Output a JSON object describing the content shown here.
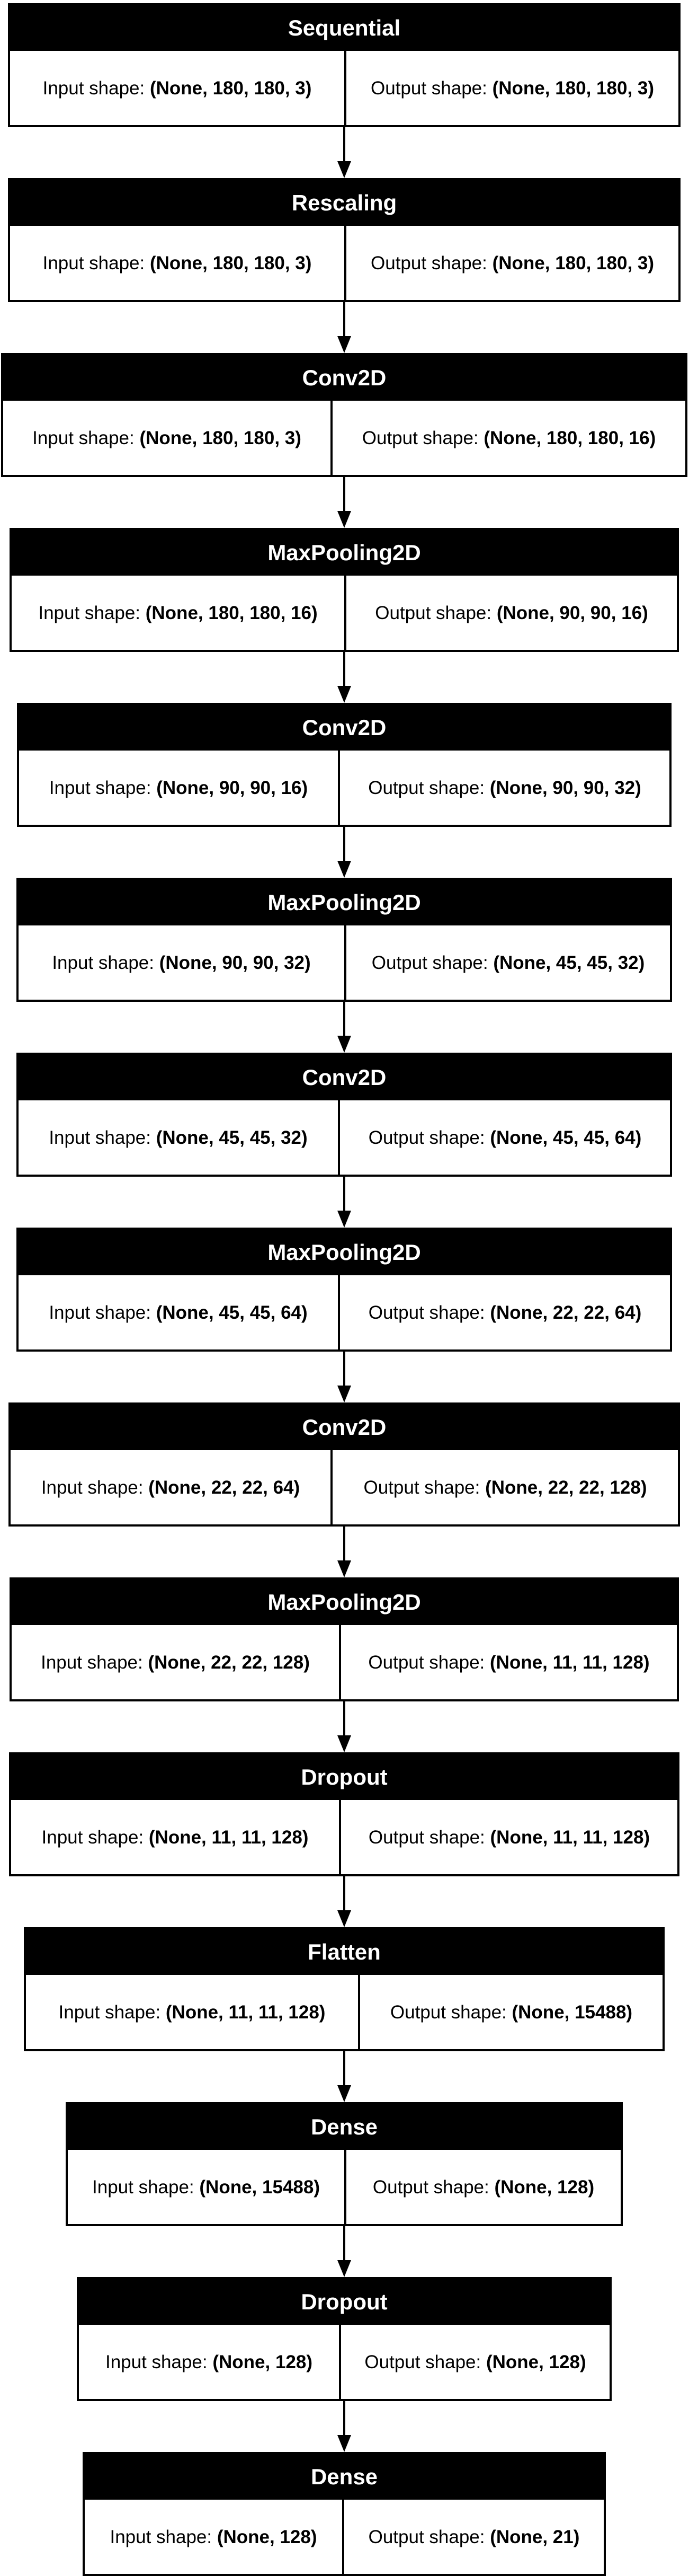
{
  "labels": {
    "input": "Input shape: ",
    "output": "Output shape: "
  },
  "colors": {
    "header": "#000000",
    "header_text": "#ffffff",
    "border": "#000000",
    "background": "#ffffff"
  },
  "layers": [
    {
      "name": "Sequential",
      "input": "(None, 180, 180, 3)",
      "output": "(None, 180, 180, 3)"
    },
    {
      "name": "Rescaling",
      "input": "(None, 180, 180, 3)",
      "output": "(None, 180, 180, 3)"
    },
    {
      "name": "Conv2D",
      "input": "(None, 180, 180, 3)",
      "output": "(None, 180, 180, 16)"
    },
    {
      "name": "MaxPooling2D",
      "input": "(None, 180, 180, 16)",
      "output": "(None, 90, 90, 16)"
    },
    {
      "name": "Conv2D",
      "input": "(None, 90, 90, 16)",
      "output": "(None, 90, 90, 32)"
    },
    {
      "name": "MaxPooling2D",
      "input": "(None, 90, 90, 32)",
      "output": "(None, 45, 45, 32)"
    },
    {
      "name": "Conv2D",
      "input": "(None, 45, 45, 32)",
      "output": "(None, 45, 45, 64)"
    },
    {
      "name": "MaxPooling2D",
      "input": "(None, 45, 45, 64)",
      "output": "(None, 22, 22, 64)"
    },
    {
      "name": "Conv2D",
      "input": "(None, 22, 22, 64)",
      "output": "(None, 22, 22, 128)"
    },
    {
      "name": "MaxPooling2D",
      "input": "(None, 22, 22, 128)",
      "output": "(None, 11, 11, 128)"
    },
    {
      "name": "Dropout",
      "input": "(None, 11, 11, 128)",
      "output": "(None, 11, 11, 128)"
    },
    {
      "name": "Flatten",
      "input": "(None, 11, 11, 128)",
      "output": "(None, 15488)"
    },
    {
      "name": "Dense",
      "input": "(None, 15488)",
      "output": "(None, 128)"
    },
    {
      "name": "Dropout",
      "input": "(None, 128)",
      "output": "(None, 128)"
    },
    {
      "name": "Dense",
      "input": "(None, 128)",
      "output": "(None, 21)"
    }
  ]
}
